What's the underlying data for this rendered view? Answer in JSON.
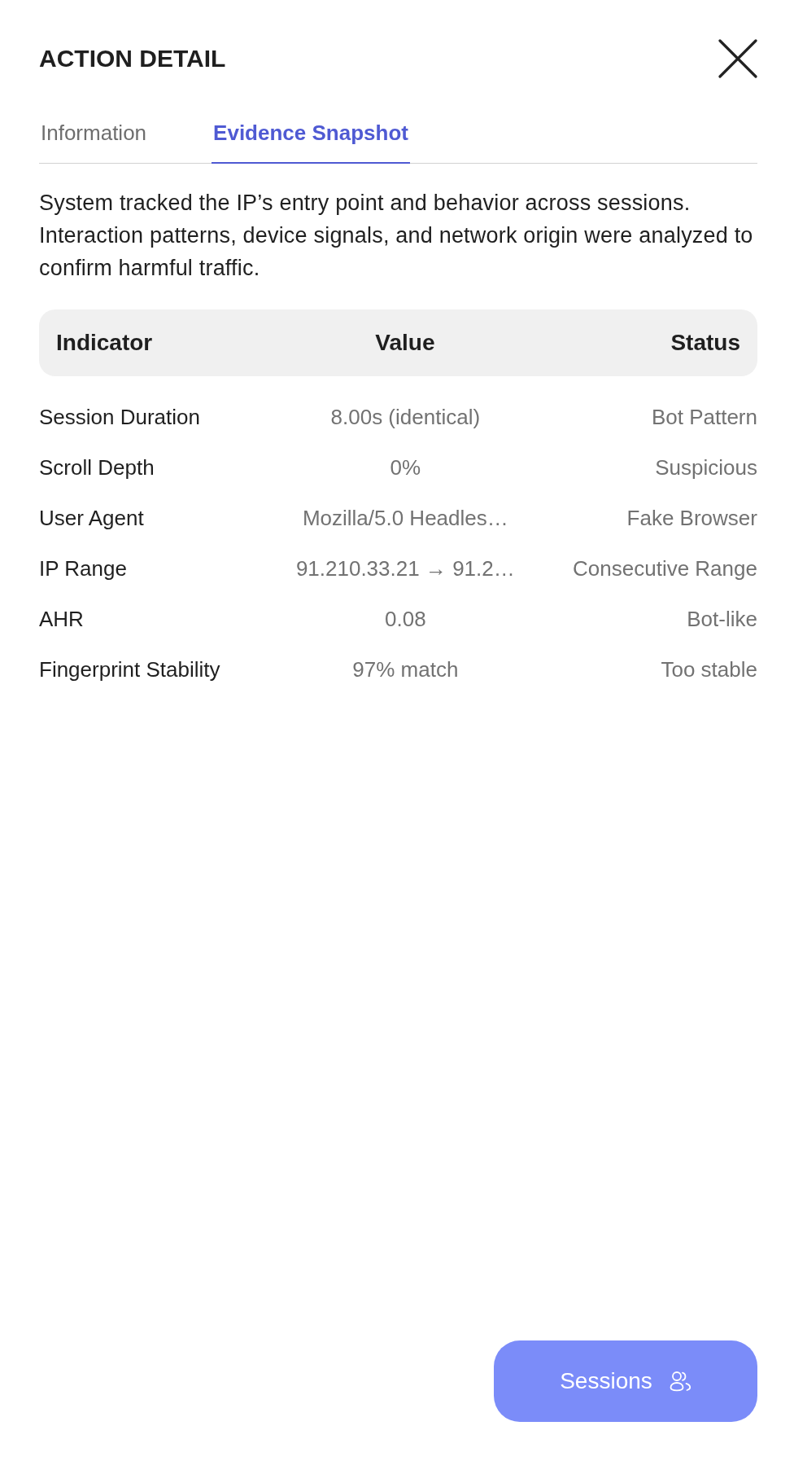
{
  "header": {
    "title": "ACTION DETAIL"
  },
  "tabs": [
    {
      "label": "Information",
      "selected": false
    },
    {
      "label": "Evidence Snapshot",
      "selected": true
    }
  ],
  "description": "System tracked the IP’s entry point and behavior across sessions. Interaction patterns, device signals, and network origin were analyzed to confirm harmful traffic.",
  "table": {
    "columns": [
      "Indicator",
      "Value",
      "Status"
    ],
    "rows": [
      {
        "indicator": "Session Duration",
        "value": "8.00s (identical)",
        "status": "Bot Pattern"
      },
      {
        "indicator": "Scroll Depth",
        "value": "0%",
        "status": "Suspicious"
      },
      {
        "indicator": "User Agent",
        "value": "Mozilla/5.0 Headles…",
        "status": "Fake Browser"
      },
      {
        "indicator": "IP Range",
        "value": "91.210.33.21 → 91.2…",
        "status": "Consecutive Range"
      },
      {
        "indicator": "AHR",
        "value": "0.08",
        "status": "Bot-like"
      },
      {
        "indicator": "Fingerprint Stability",
        "value": "97% match",
        "status": "Too stable"
      }
    ]
  },
  "footer": {
    "button": "Sessions"
  }
}
